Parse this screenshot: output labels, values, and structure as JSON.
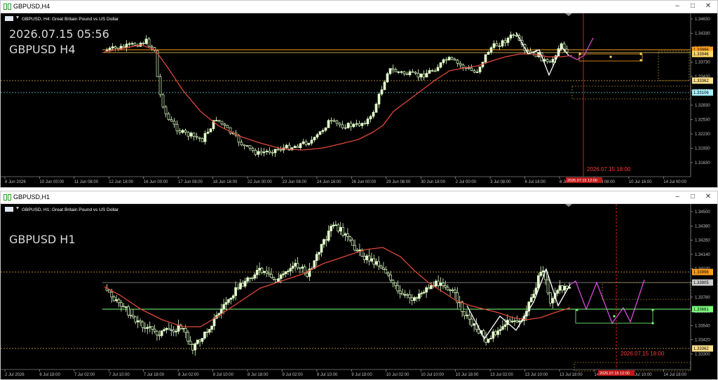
{
  "windows": [
    {
      "id": "h4",
      "title": "GBPUSD,H4",
      "symbol_desc": "GBPUSD, H4:  Great Britain Pound vs US Dollar",
      "overlay_time": "2026.07.15 05:56",
      "overlay_symbol": "GBPUSD H4",
      "vline_label": "2026.07.15 18:00",
      "time_tag": "2026.07.15 12:00",
      "price_axis": [
        "1.34630",
        "1.34330",
        "1.34030",
        "1.33730",
        "1.33430",
        "1.33130",
        "1.32830",
        "1.32530",
        "1.32230",
        "1.31930",
        "1.31630"
      ],
      "price_tags": [
        {
          "label": "1.33996",
          "color": "#ff9f1c"
        },
        {
          "label": "1.33946",
          "color": "#ffd966"
        },
        {
          "label": "1.33362",
          "color": "#ffe08a"
        },
        {
          "label": "1.33106",
          "color": "#a8f0ff"
        }
      ],
      "time_axis": [
        "8 Jun 2026",
        "10 Jun 00:00",
        "11 Jun 08:00",
        "12 Jun 16:00",
        "16 Jun 00:00",
        "17 Jun 08:00",
        "18 Jun 16:00",
        "22 Jun 00:00",
        "23 Jun 08:00",
        "24 Jun 16:00",
        "26 Jun 00:00",
        "29 Jun 08:00",
        "30 Jun 16:00",
        "2 Jul 00:00",
        "3 Jul 08:00",
        "6 Jul 16:00",
        "8 Jul 00:00",
        "9 Jul 08:00",
        "10 Jul 16:00",
        "14 Jul 00:00"
      ]
    },
    {
      "id": "h1",
      "title": "GBPUSD,H1",
      "symbol_desc": "GBPUSD, H1:  Great Britain Pound vs US Dollar",
      "overlay_time": "",
      "overlay_symbol": "GBPUSD H1",
      "vline_label": "2026.07.15 18:00",
      "time_tag": "2026.07.15 12:00",
      "price_axis": [
        "1.34500",
        "1.34380",
        "1.34260",
        "1.34140",
        "1.34020",
        "1.33900",
        "1.33780",
        "1.33660",
        "1.33540",
        "1.33420",
        "1.33300"
      ],
      "price_tags": [
        {
          "label": "1.33996",
          "color": "#ff9f1c"
        },
        {
          "label": "1.33905",
          "color": "#cfcfcf"
        },
        {
          "label": "1.33681",
          "color": "#7dff7d"
        },
        {
          "label": "1.33362",
          "color": "#ffe08a"
        }
      ],
      "time_axis": [
        "2 Jul 2026",
        "6 Jul 18:00",
        "7 Jul 02:00",
        "7 Jul 10:00",
        "7 Jul 18:00",
        "8 Jul 02:00",
        "8 Jul 10:00",
        "8 Jul 18:00",
        "9 Jul 02:00",
        "9 Jul 10:00",
        "9 Jul 18:00",
        "10 Jul 02:00",
        "10 Jul 10:00",
        "10 Jul 18:00",
        "13 Jul 02:00",
        "13 Jul 10:00",
        "13 Jul 18:00",
        "14 Jul 02:00",
        "14 Jul 10:00",
        "14 Jul 18:00"
      ]
    }
  ],
  "colors": {
    "bull": "#e8ffd0",
    "bear": "#ffffff",
    "ma": "#e0473a",
    "forecast": "#d24bd8",
    "zigzag": "#ffffff",
    "vline": "#ff2a2a",
    "green_line": "#7dff7d",
    "orange_line": "#ff9f1c"
  }
}
